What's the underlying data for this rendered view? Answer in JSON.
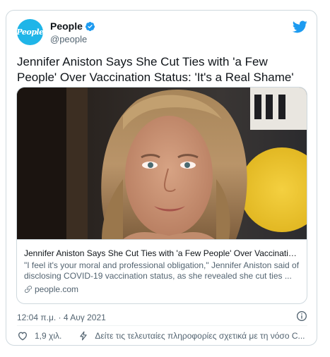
{
  "account": {
    "avatar_text": "People",
    "display_name": "People",
    "handle": "@people",
    "verified": true
  },
  "tweet": {
    "text": "Jennifer Aniston Says She Cut Ties with 'a Few People' Over Vaccination Status: 'It's a Real Shame'"
  },
  "link_card": {
    "title": "Jennifer Aniston Says She Cut Ties with 'a Few People' Over Vaccination ...",
    "description": "\"I feel it's your moral and professional obligation,\" Jennifer Aniston said of disclosing COVID-19 vaccination status, as she revealed she cut ties ...",
    "domain": "people.com"
  },
  "meta": {
    "timestamp": "12:04 π.μ. · 4 Αυγ 2021"
  },
  "actions": {
    "like_count": "1,9 χιλ.",
    "covid_notice": "Δείτε τις τελευταίες πληροφορίες σχετικά με τη νόσο C..."
  },
  "colors": {
    "twitter_blue": "#1d9bf0",
    "avatar_bg": "#1fb5e8",
    "secondary_text": "#536471",
    "border": "#cfd9de"
  }
}
